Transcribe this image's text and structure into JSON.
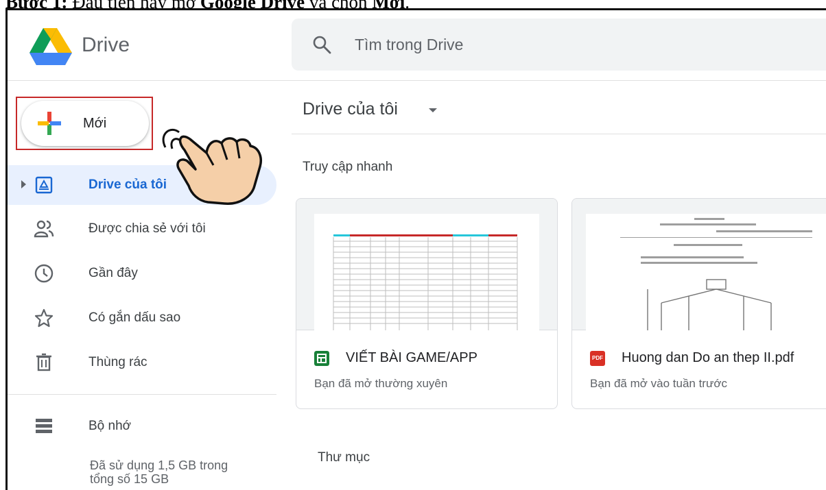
{
  "caption": {
    "step": "Bước 1:",
    "text_a": " Đầu tiên hãy mở ",
    "bold_app": "Google Drive",
    "text_b": " và chọn ",
    "bold_action": "Mới",
    "end": "."
  },
  "header": {
    "app_name": "Drive",
    "search_placeholder": "Tìm trong Drive"
  },
  "sidebar": {
    "new_label": "Mới",
    "items": [
      {
        "label": "Drive của tôi",
        "icon": "my-drive-icon",
        "active": true
      },
      {
        "label": "Được chia sẻ với tôi",
        "icon": "shared-people-icon"
      },
      {
        "label": "Gần đây",
        "icon": "clock-icon"
      },
      {
        "label": "Có gắn dấu sao",
        "icon": "star-icon"
      },
      {
        "label": "Thùng rác",
        "icon": "trash-icon"
      }
    ],
    "storage": {
      "label": "Bộ nhớ",
      "icon": "storage-icon",
      "used_line1": "Đã sử dụng 1,5 GB trong",
      "used_line2": "tổng số 15 GB"
    }
  },
  "main": {
    "breadcrumb": "Drive của tôi",
    "quick_access_title": "Truy cập nhanh",
    "files": [
      {
        "name": "VIẾT BÀI GAME/APP",
        "subtitle": "Bạn đã mở thường xuyên",
        "icon": "sheets-icon"
      },
      {
        "name": "Huong dan Do an thep II.pdf",
        "subtitle": "Bạn đã mở vào tuần trước",
        "icon": "pdf-icon",
        "pdf_tag": "PDF"
      }
    ],
    "folders_title": "Thư mục"
  },
  "colors": {
    "accent_blue": "#1967d2",
    "active_bg": "#e8f0fe",
    "highlight_red": "#c62828",
    "sheets_green": "#188038",
    "pdf_red": "#d93025"
  }
}
